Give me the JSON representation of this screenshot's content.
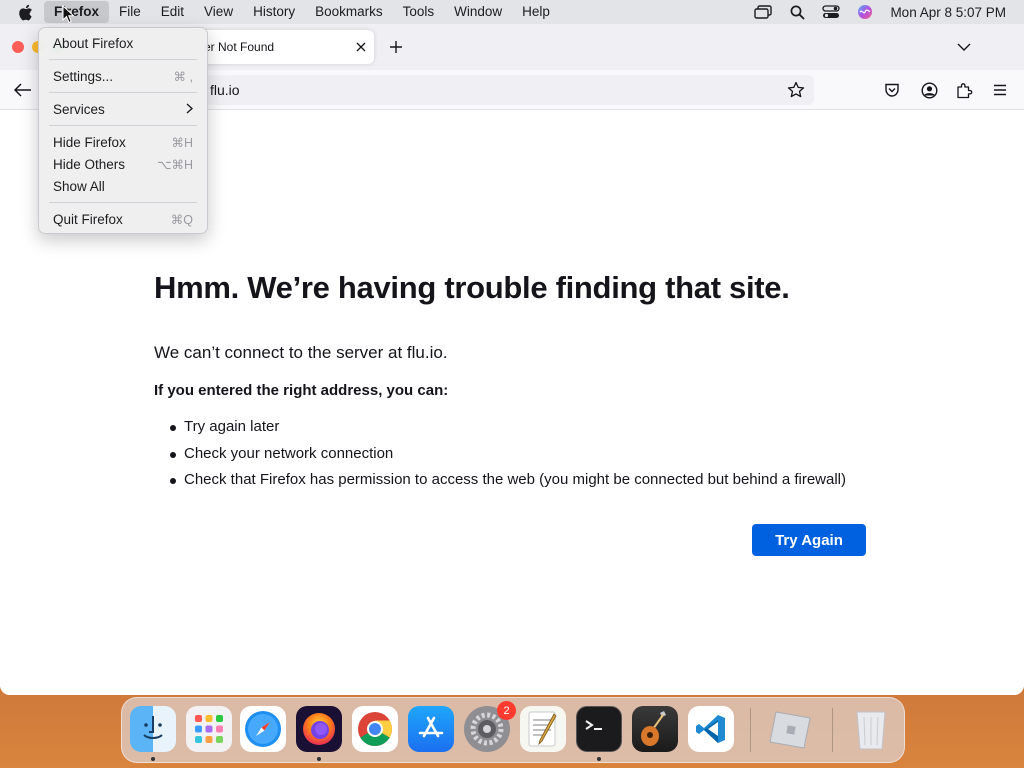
{
  "menubar": {
    "app_name": "Firefox",
    "menus": [
      "File",
      "Edit",
      "View",
      "History",
      "Bookmarks",
      "Tools",
      "Window",
      "Help"
    ],
    "clock": "Mon Apr 8  5:07 PM"
  },
  "app_menu": {
    "about": "About Firefox",
    "settings": "Settings...",
    "settings_shortcut": "⌘ ,",
    "services": "Services",
    "hide": "Hide Firefox",
    "hide_shortcut": "⌘H",
    "hide_others": "Hide Others",
    "hide_others_shortcut": "⌥⌘H",
    "show_all": "Show All",
    "quit": "Quit Firefox",
    "quit_shortcut": "⌘Q"
  },
  "tab": {
    "title": "er Not Found"
  },
  "urlbar": {
    "value": "flu.io"
  },
  "error": {
    "title": "Hmm. We’re having trouble finding that site.",
    "description": "We can’t connect to the server at flu.io.",
    "subheading": "If you entered the right address, you can:",
    "suggestions": [
      "Try again later",
      "Check your network connection",
      "Check that Firefox has permission to access the web (you might be connected but behind a firewall)"
    ],
    "button": "Try Again"
  },
  "dock": {
    "settings_badge": "2"
  },
  "colors": {
    "accent": "#0061e0",
    "close": "#ff5f57",
    "minimize": "#febc2e",
    "badge": "#ff3b30"
  }
}
